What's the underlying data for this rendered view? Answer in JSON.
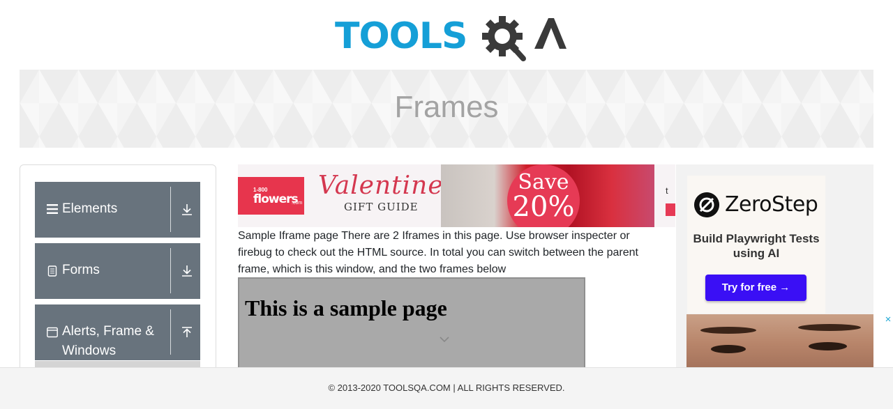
{
  "header": {
    "logo_part1": "TOOLS",
    "logo_part2": "A"
  },
  "banner": {
    "title": "Frames"
  },
  "sidebar": {
    "groups": [
      {
        "label": "Elements",
        "icon": "hamburger-icon",
        "arrow": "download-arrow-icon"
      },
      {
        "label": "Forms",
        "icon": "document-icon",
        "arrow": "download-arrow-icon"
      },
      {
        "label": "Alerts, Frame & Windows",
        "icon": "browser-window-icon",
        "arrow": "upload-arrow-icon"
      }
    ]
  },
  "ad_top": {
    "brand_small": "1-800",
    "brand_name": "flowers",
    "brand_tld": ".com",
    "headline": "Valentine's",
    "subline": "GIFT GUIDE",
    "save_line1": "Save",
    "save_line2": "20%",
    "edge_text": "t"
  },
  "content": {
    "description": "Sample Iframe page There are 2 Iframes in this page. Use browser inspecter or firebug to check out the HTML source. In total you can switch between the parent frame, which is this window, and the two frames below",
    "frame_heading": "This is a sample page"
  },
  "ad_right": {
    "brand": "ZeroStep",
    "tagline": "Build Playwright Tests using AI",
    "button": "Try for free →",
    "close": "×"
  },
  "footer": {
    "text": "© 2013-2020 TOOLSQA.COM | ALL RIGHTS RESERVED."
  },
  "colors": {
    "logo_blue": "#159fd7",
    "logo_dark": "#3a3a3a",
    "sidebar_group_bg": "#68737d",
    "zerostep_button": "#3a0ff5",
    "flowers_red": "#e7354d"
  }
}
